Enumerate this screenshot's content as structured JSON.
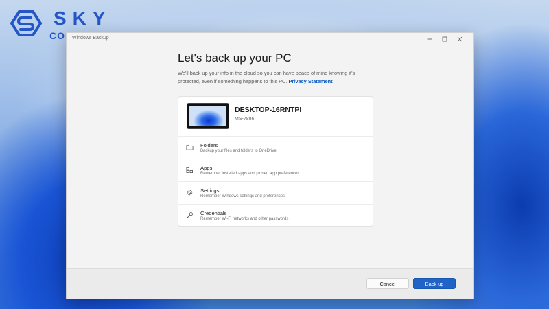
{
  "logo": {
    "line1": "SKY",
    "line2": "COMPUTER",
    "icon": "sky-computer-logo"
  },
  "window": {
    "title": "Windows Backup",
    "controls": [
      "minimize-icon",
      "maximize-icon",
      "close-icon"
    ]
  },
  "main": {
    "heading": "Let's back up your PC",
    "description": "We'll back up your info in the cloud so you can have peace of mind knowing it's protected, even if something happens to this PC.",
    "privacy_link": "Privacy Statement"
  },
  "device": {
    "name": "DESKTOP-16RNTPI",
    "model": "MS-7886"
  },
  "options": [
    {
      "title": "Folders",
      "subtitle": "Backup your files and folders to OneDrive",
      "icon": "folder-icon"
    },
    {
      "title": "Apps",
      "subtitle": "Remember installed apps and pinned app preferences",
      "icon": "apps-icon"
    },
    {
      "title": "Settings",
      "subtitle": "Remember Windows settings and preferences",
      "icon": "gear-icon"
    },
    {
      "title": "Credentials",
      "subtitle": "Remember Wi-Fi networks and other passwords",
      "icon": "key-icon"
    }
  ],
  "footer": {
    "cancel_label": "Cancel",
    "primary_label": "Back up"
  },
  "colors": {
    "accent": "#1f63c6",
    "link": "#0a5cc2",
    "logo": "#2456c7"
  }
}
